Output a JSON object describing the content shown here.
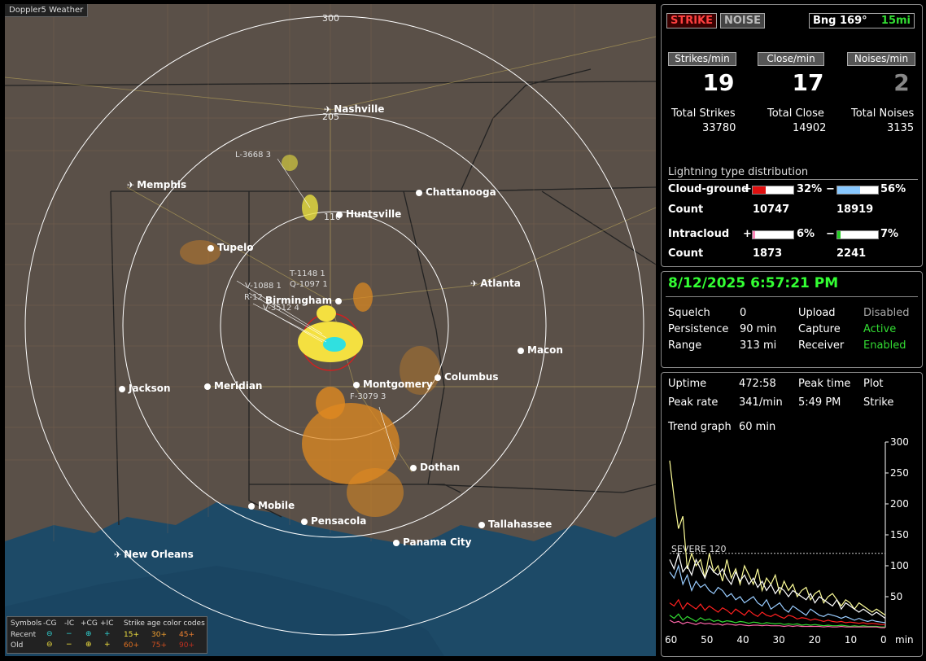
{
  "map": {
    "brand": "Doppler5 Weather",
    "rings": [
      "300",
      "205",
      "110"
    ],
    "cities": [
      {
        "name": "Nashville",
        "type": "plane"
      },
      {
        "name": "Memphis",
        "type": "plane"
      },
      {
        "name": "Chattanooga",
        "type": "dot"
      },
      {
        "name": "Huntsville",
        "type": "dot"
      },
      {
        "name": "Tupelo",
        "type": "dot"
      },
      {
        "name": "Atlanta",
        "type": "plane"
      },
      {
        "name": "Birmingham",
        "type": "dot"
      },
      {
        "name": "Macon",
        "type": "dot"
      },
      {
        "name": "Jackson",
        "type": "dot"
      },
      {
        "name": "Meridian",
        "type": "dot"
      },
      {
        "name": "Montgomery",
        "type": "dot"
      },
      {
        "name": "Columbus",
        "type": "dot"
      },
      {
        "name": "Dothan",
        "type": "dot"
      },
      {
        "name": "Mobile",
        "type": "dot"
      },
      {
        "name": "Pensacola",
        "type": "dot"
      },
      {
        "name": "Tallahassee",
        "type": "dot"
      },
      {
        "name": "Panama City",
        "type": "dot"
      },
      {
        "name": "New Orleans",
        "type": "plane"
      }
    ],
    "sensors": [
      "L-3668 3",
      "T-1148 1",
      "Q-1097 1",
      "V-1088 1",
      "R-12",
      "V-3512 4",
      "F-3079 3"
    ],
    "legend": {
      "symbols": "Symbols",
      "cols": [
        "-CG",
        "-IC",
        "+CG",
        "+IC"
      ],
      "age_title": "Strike age color codes",
      "recent": "Recent",
      "old": "Old",
      "recent_ages": [
        "15+",
        "30+",
        "45+"
      ],
      "old_ages": [
        "60+",
        "75+",
        "90+"
      ]
    }
  },
  "top": {
    "strike_btn": "STRIKE",
    "noise_btn": "NOISE",
    "bearing": "Bng 169°",
    "distance": "15mi",
    "hdr_strikes": "Strikes/min",
    "hdr_close": "Close/min",
    "hdr_noises": "Noises/min",
    "strikes_min": "19",
    "close_min": "17",
    "noises_min": "2",
    "lbl_total_strikes": "Total Strikes",
    "lbl_total_close": "Total Close",
    "lbl_total_noises": "Total Noises",
    "total_strikes": "33780",
    "total_close": "14902",
    "total_noises": "3135",
    "dist_title": "Lightning type distribution",
    "cg_label": "Cloud-ground",
    "ic_label": "Intracloud",
    "count_label": "Count",
    "plus": "+",
    "minus": "−",
    "cg_pos_pct": "32%",
    "cg_neg_pct": "56%",
    "cg_pos_count": "10747",
    "cg_neg_count": "18919",
    "ic_pos_pct": "6%",
    "ic_neg_pct": "7%",
    "ic_pos_count": "1873",
    "ic_neg_count": "2241",
    "fills": {
      "cg_pos": 0.32,
      "cg_neg": 0.56,
      "ic_pos": 0.06,
      "ic_neg": 0.07
    },
    "colors": {
      "cg_pos": "#e01010",
      "cg_neg": "#88c8ff",
      "ic_pos": "#ff88bb",
      "ic_neg": "#22cc22"
    }
  },
  "status": {
    "datetime": "8/12/2025 6:57:21 PM",
    "squelch_lbl": "Squelch",
    "squelch": "0",
    "persistence_lbl": "Persistence",
    "persistence": "90 min",
    "range_lbl": "Range",
    "range": "313 mi",
    "upload_lbl": "Upload",
    "upload": "Disabled",
    "capture_lbl": "Capture",
    "capture": "Active",
    "receiver_lbl": "Receiver",
    "receiver": "Enabled"
  },
  "stats": {
    "uptime_lbl": "Uptime",
    "uptime": "472:58",
    "peaktime_lbl": "Peak time",
    "plot_lbl": "Plot",
    "peakrate_lbl": "Peak rate",
    "peakrate": "341/min",
    "peaktime": "5:49 PM",
    "plot": "Strike",
    "trend_lbl": "Trend graph",
    "trend": "60 min"
  },
  "chart_data": {
    "type": "line",
    "xlabel": "min",
    "x_ticks": [
      "60",
      "50",
      "40",
      "30",
      "20",
      "10",
      "0"
    ],
    "y_ticks": [
      "300",
      "250",
      "200",
      "150",
      "100",
      "50"
    ],
    "ylim": [
      0,
      300
    ],
    "xlim": [
      60,
      0
    ],
    "threshold": {
      "label": "SEVERE 120",
      "value": 120
    },
    "series": [
      {
        "color": "#ffff99",
        "values": [
          270,
          210,
          160,
          180,
          95,
          120,
          100,
          110,
          80,
          120,
          90,
          100,
          75,
          110,
          80,
          95,
          70,
          100,
          85,
          70,
          95,
          60,
          80,
          70,
          85,
          55,
          75,
          60,
          70,
          50,
          60,
          65,
          45,
          55,
          60,
          40,
          50,
          55,
          45,
          35,
          45,
          40,
          30,
          40,
          35,
          30,
          25,
          30,
          25,
          20
        ]
      },
      {
        "color": "#ffffff",
        "values": [
          110,
          95,
          120,
          90,
          100,
          85,
          110,
          95,
          80,
          100,
          90,
          85,
          95,
          80,
          70,
          90,
          75,
          85,
          70,
          80,
          65,
          75,
          60,
          70,
          55,
          65,
          60,
          50,
          60,
          55,
          50,
          45,
          55,
          40,
          50,
          45,
          40,
          35,
          45,
          30,
          40,
          35,
          30,
          25,
          30,
          25,
          20,
          25,
          20,
          15
        ]
      },
      {
        "color": "#99ccff",
        "values": [
          90,
          80,
          100,
          70,
          85,
          60,
          75,
          65,
          70,
          60,
          55,
          65,
          60,
          50,
          55,
          45,
          50,
          40,
          45,
          50,
          40,
          35,
          45,
          30,
          35,
          40,
          30,
          25,
          35,
          30,
          25,
          20,
          30,
          25,
          20,
          18,
          22,
          20,
          18,
          15,
          18,
          15,
          12,
          15,
          12,
          10,
          12,
          10,
          9,
          8
        ]
      },
      {
        "color": "#ff2020",
        "values": [
          40,
          35,
          45,
          30,
          40,
          35,
          30,
          38,
          28,
          35,
          30,
          25,
          32,
          28,
          22,
          30,
          25,
          20,
          28,
          22,
          18,
          25,
          20,
          18,
          22,
          18,
          15,
          20,
          18,
          14,
          16,
          15,
          12,
          14,
          12,
          10,
          12,
          10,
          9,
          10,
          8,
          9,
          8,
          7,
          8,
          6,
          7,
          6,
          5,
          5
        ]
      },
      {
        "color": "#33dd33",
        "values": [
          20,
          15,
          22,
          12,
          18,
          14,
          10,
          16,
          12,
          14,
          10,
          12,
          9,
          11,
          10,
          8,
          10,
          9,
          7,
          9,
          8,
          6,
          8,
          7,
          6,
          7,
          5,
          6,
          5,
          6,
          4,
          5,
          4,
          5,
          4,
          3,
          4,
          3,
          3,
          4,
          3,
          2,
          3,
          2,
          3,
          2,
          2,
          2,
          1,
          1
        ]
      },
      {
        "color": "#ff66aa",
        "values": [
          12,
          8,
          10,
          6,
          9,
          7,
          5,
          8,
          6,
          7,
          5,
          6,
          4,
          6,
          5,
          4,
          5,
          4,
          3,
          4,
          4,
          3,
          4,
          3,
          3,
          3,
          2,
          3,
          2,
          3,
          2,
          2,
          2,
          2,
          2,
          1,
          2,
          1,
          1,
          2,
          1,
          1,
          1,
          1,
          1,
          1,
          1,
          1,
          0,
          0
        ]
      }
    ]
  }
}
